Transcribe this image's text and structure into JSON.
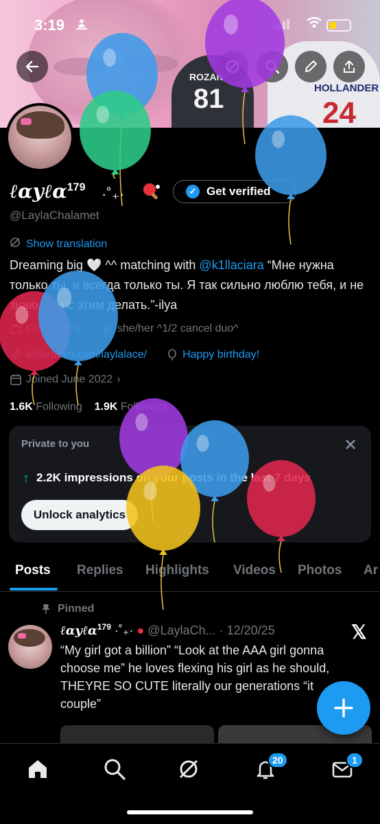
{
  "status_bar": {
    "time": "3:19",
    "battery_color": "#ffd60a"
  },
  "banner": {
    "jersey_left_name": "ROZAN",
    "jersey_left_number": "81",
    "jersey_right_name": "HOLLANDER",
    "jersey_right_number": "24"
  },
  "profile": {
    "display_name": "ℓαуℓα",
    "name_sup": "179",
    "name_decoration": "·˚₊·",
    "handle": "@LaylaChalamet",
    "verify_label": "Get verified",
    "translate_label": "Show translation",
    "bio_part1": "Dreaming big 🤍 ^^ matching with ",
    "bio_mention": "@k1llaciara",
    "bio_part2": " “Мне нужна только ты, и всегда только ты. Я так сильно люблю тебя, и не знаю, что с этим делать.”-ilya",
    "community": "Community",
    "location": "she/her ^1/2 cancel duo^",
    "website": "letterboxd.com/laylalace/",
    "birthday": "Happy birthday!",
    "joined": "Joined June 2022",
    "following_count": "1.6K",
    "following_label": "Following",
    "followers_count": "1.9K",
    "followers_label": "Followers"
  },
  "analytics_card": {
    "private_label": "Private to you",
    "impressions_text": "2.2K impressions on your posts in the last 7 days",
    "unlock_label": "Unlock analytics"
  },
  "tabs": [
    "Posts",
    "Replies",
    "Highlights",
    "Videos",
    "Photos",
    "Ar"
  ],
  "post": {
    "pinned_label": "Pinned",
    "author_name": "ℓαуℓα",
    "author_sup": "179",
    "author_deco": "·˚₊·",
    "handle_time": "@LaylaCh... · 12/20/25",
    "text": "“My girl got a billion” “Look at the AAA girl gonna choose me” he loves flexing his girl as he should, THEYRE SO CUTE literally our generations “it couple”"
  },
  "nav": {
    "notifications_badge": "20",
    "messages_badge": "1"
  },
  "accent_color": "#1d9bf0",
  "balloons": [
    {
      "color": "#a13be0",
      "id": "b1"
    },
    {
      "color": "#3d9be9",
      "id": "b2"
    },
    {
      "color": "#2ecc8a",
      "id": "b3"
    },
    {
      "color": "#3d9be9",
      "id": "b4"
    },
    {
      "color": "#e0264f",
      "id": "b5"
    },
    {
      "color": "#3d9be9",
      "id": "b6"
    },
    {
      "color": "#a13be0",
      "id": "b7"
    },
    {
      "color": "#3d9be9",
      "id": "b8"
    },
    {
      "color": "#f2c21e",
      "id": "b9"
    },
    {
      "color": "#e0264f",
      "id": "b10"
    }
  ]
}
